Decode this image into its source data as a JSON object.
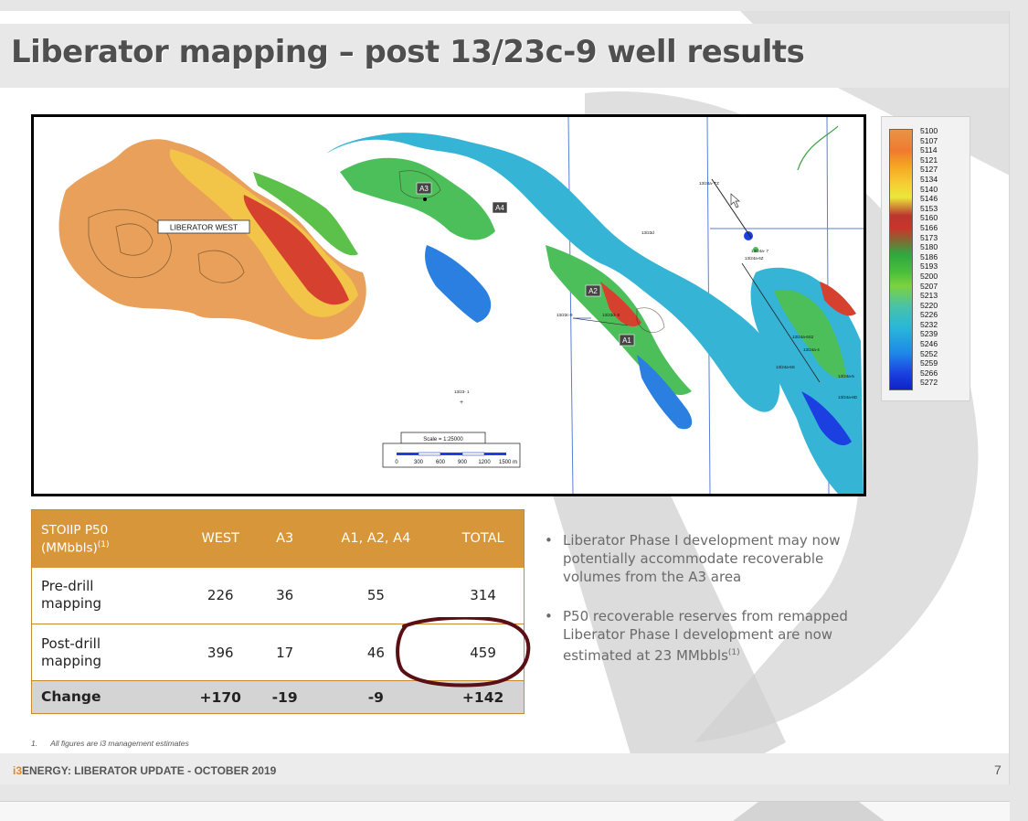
{
  "slide": {
    "title": "Liberator mapping – post 13/23c-9 well results",
    "page_number": "7",
    "footer": {
      "brand_mark": "i3",
      "brand_name": "ENERGY",
      "text": ": LIBERATOR UPDATE - OCTOBER 2019"
    },
    "footnote": {
      "number": "1.",
      "text": "All figures are i3 management estimates"
    }
  },
  "map": {
    "field_label": "LIBERATOR WEST",
    "area_labels": [
      "A3",
      "A4",
      "A2",
      "A1"
    ],
    "well_labels": [
      "13/24a- TZ",
      "13/24a- 7",
      "13/24a-6Z",
      "13/23c-9",
      "13/23d- 8",
      "13/23d",
      "13/24a-6S2",
      "13/24a-4",
      "13/24a-6S",
      "13/24a-5",
      "13/24a-6D",
      "13/23- 1"
    ],
    "scale_label": "Scale = 1:25000",
    "scale_ticks": [
      "0",
      "300",
      "600",
      "900",
      "1200",
      "1500 m"
    ]
  },
  "legend": {
    "values": [
      "5100",
      "5107",
      "5114",
      "5121",
      "5127",
      "5134",
      "5140",
      "5146",
      "5153",
      "5160",
      "5166",
      "5173",
      "5180",
      "5186",
      "5193",
      "5200",
      "5207",
      "5213",
      "5220",
      "5226",
      "5232",
      "5239",
      "5246",
      "5252",
      "5259",
      "5266",
      "5272"
    ]
  },
  "table": {
    "header": {
      "metric_line1": "STOIIP P50",
      "metric_line2": "(MMbbls)",
      "metric_sup": "(1)",
      "col_west": "WEST",
      "col_a3": "A3",
      "col_a1a2a4": "A1, A2, A4",
      "col_total": "TOTAL"
    },
    "rows": [
      {
        "label_line1": "Pre-drill",
        "label_line2": "mapping",
        "west": "226",
        "a3": "36",
        "a1a2a4": "55",
        "total": "314"
      },
      {
        "label_line1": "Post-drill",
        "label_line2": "mapping",
        "west": "396",
        "a3": "17",
        "a1a2a4": "46",
        "total": "459"
      }
    ],
    "change": {
      "label": "Change",
      "west": "+170",
      "a3": "-19",
      "a1a2a4": "-9",
      "total": "+142"
    }
  },
  "bullets": [
    {
      "text": "Liberator Phase I development may now potentially accommodate recoverable volumes from the A3 area",
      "sup": ""
    },
    {
      "text": "P50 recoverable reserves from remapped Liberator Phase I development are now estimated at 23 MMbbls",
      "sup": "(1)"
    }
  ],
  "colors": {
    "table_header": "#d8963a",
    "annotation_circle": "#5a0f14",
    "legend_top": "#e89446",
    "legend_bottom": "#1022c8"
  }
}
